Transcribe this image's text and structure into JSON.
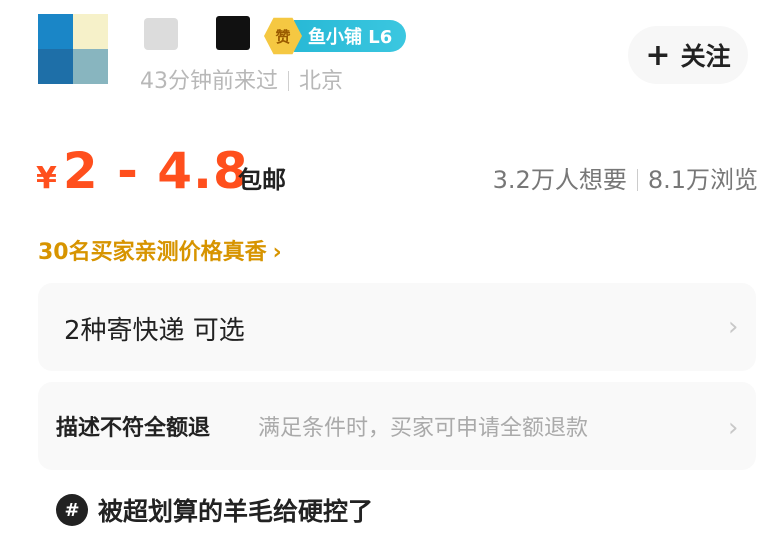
{
  "seller": {
    "badge_icon": "赞",
    "badge_label": "鱼小铺 L6",
    "last_seen": "43分钟前来过",
    "location": "北京",
    "follow_label": "关注",
    "follow_icon": "plus-icon"
  },
  "price": {
    "currency": "¥",
    "range": "2 - 4.8",
    "shipping": "包邮",
    "wants": "3.2万人想要",
    "views": "8.1万浏览"
  },
  "promo": {
    "text": "30名买家亲测价格真香",
    "chevron": "›"
  },
  "options": {
    "delivery": "2种寄快递 可选",
    "refund_title": "描述不符全额退",
    "refund_desc": "满足条件时，买家可申请全额退款",
    "chevron": "›"
  },
  "topic": {
    "icon": "#",
    "text": "被超划算的羊毛给硬控了"
  },
  "colors": {
    "price": "#ff4f1d",
    "promo": "#d79400",
    "badge_pill": "#28b9d6",
    "badge_hex": "#f5c842"
  }
}
